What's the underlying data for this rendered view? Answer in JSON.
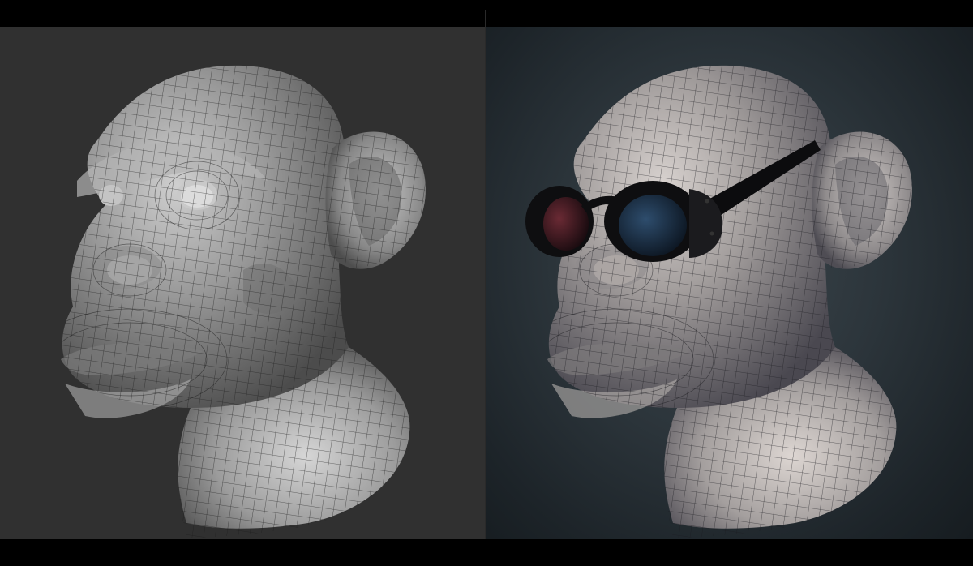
{
  "scene": {
    "description_panels": [
      {
        "id": "clay-render",
        "background": "#303030",
        "material": "matcap-gray"
      },
      {
        "id": "lit-render",
        "background": "#28323a",
        "material": "skin-lit",
        "accessory": "round-dark-sunglasses"
      }
    ],
    "colors": {
      "clay_light": "#bdbdbd",
      "clay_mid": "#8c8c8c",
      "clay_dark": "#4a4a4a",
      "wire": "#1a1a1a",
      "lens_red": "#4a1a22",
      "lens_blue": "#1c3550",
      "frame": "#0e0e10"
    }
  }
}
